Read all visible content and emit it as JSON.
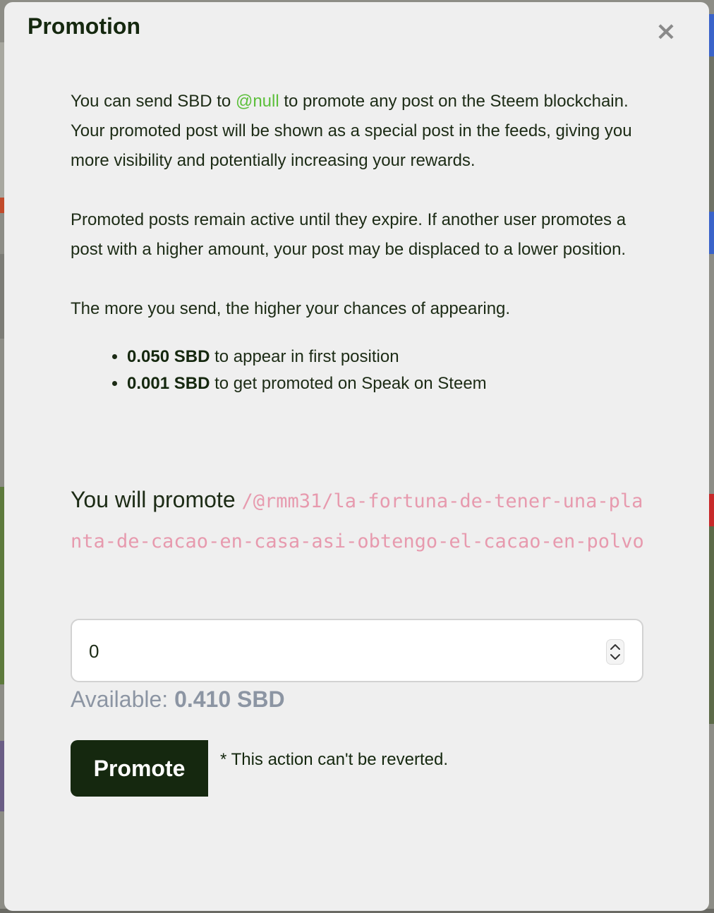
{
  "modal": {
    "title": "Promotion",
    "close_symbol": "×",
    "close_icon": "close-icon"
  },
  "intro": {
    "p1_before": "You can send SBD to ",
    "p1_link": "@null",
    "p1_after": " to promote any post on the Steem blockchain. Your promoted post will be shown as a special post in the feeds, giving you more visibility and potentially increasing your rewards.",
    "p2": "Promoted posts remain active until they expire. If another user promotes a post with a higher amount, your post may be displaced to a lower position.",
    "p3": "The more you send, the higher your chances of appearing."
  },
  "bullets": [
    {
      "amount": "0.050 SBD",
      "text": " to appear in first position"
    },
    {
      "amount": "0.001 SBD",
      "text": " to get promoted on Speak on Steem"
    }
  ],
  "promote": {
    "label": "You will promote ",
    "path": "/@rmm31/la-fortuna-de-tener-una-planta-de-cacao-en-casa-asi-obtengo-el-cacao-en-polvo"
  },
  "amount_input": {
    "value": "0"
  },
  "available": {
    "label": "Available: ",
    "value": "0.410 SBD"
  },
  "actions": {
    "promote_button": "Promote",
    "note": "* This action can't be reverted."
  },
  "colors": {
    "primary": "#15280f",
    "link": "#5cbf3b",
    "path": "#e79aae",
    "muted": "#8c95a3"
  }
}
